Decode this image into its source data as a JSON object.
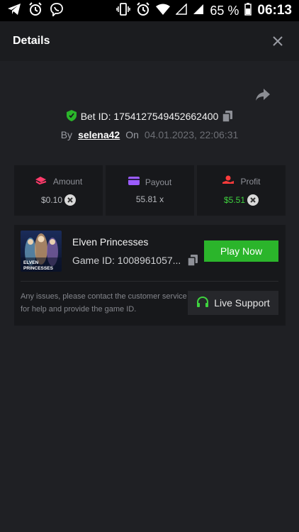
{
  "status_bar": {
    "battery": "65 %",
    "time": "06:13",
    "icons_left": [
      "telegram-icon",
      "alarm-icon",
      "viber-icon"
    ],
    "icons_right": [
      "vibrate-icon",
      "alarm-icon",
      "wifi-icon",
      "signal-empty-icon",
      "signal-icon",
      "battery-icon"
    ]
  },
  "header": {
    "title": "Details"
  },
  "bet": {
    "label": "Bet ID: 1754127549452662400",
    "by_label": "By",
    "username": "selena42",
    "on_label": "On",
    "datetime": "04.01.2023, 22:06:31"
  },
  "stats": [
    {
      "label": "Amount",
      "value": "$0.10",
      "icon": "amount-icon",
      "color": "#ff3b6b"
    },
    {
      "label": "Payout",
      "value": "55.81 x",
      "icon": "payout-card-icon",
      "color": "#9b5cff"
    },
    {
      "label": "Profit",
      "value": "$5.51",
      "icon": "profit-icon",
      "color": "#ff3b3b"
    }
  ],
  "game": {
    "name": "Elven Princesses",
    "id_text": "Game ID: 1008961057...",
    "thumb_label_1": "ELVEN",
    "thumb_label_2": "PRINCESSES",
    "play_label": "Play Now"
  },
  "support": {
    "message": "Any issues, please contact the customer service for help and provide the game ID.",
    "button_label": "Live Support"
  },
  "colors": {
    "background": "#1f2024",
    "panel": "#17181b",
    "accent_green": "#2bb52b",
    "profit_green": "#3fd33f"
  }
}
